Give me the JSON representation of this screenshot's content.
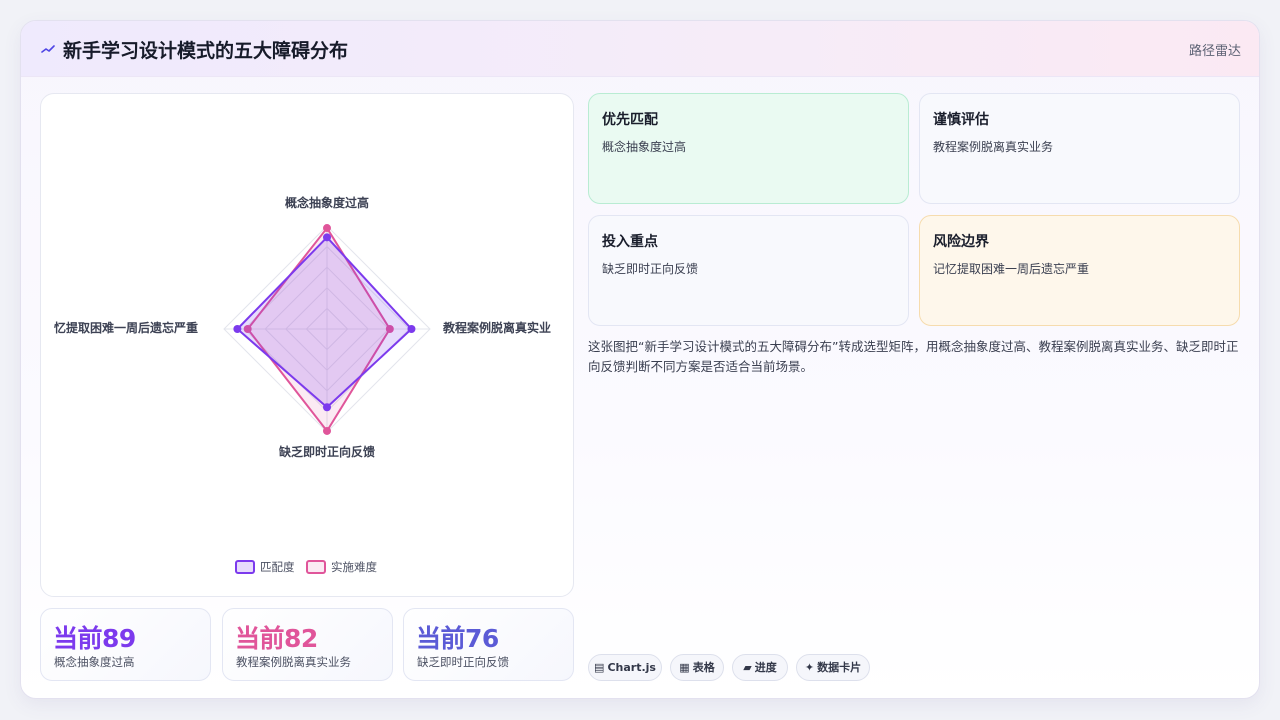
{
  "header": {
    "icon": "sparkline-icon",
    "title": "新手学习设计模式的五大障碍分布",
    "tag": "路径雷达"
  },
  "chart_data": {
    "type": "radar",
    "axes": [
      "概念抽象度过高",
      "教程案例脱离真实业务",
      "缺乏即时正向反馈",
      "记忆提取困难一周后遗忘严重"
    ],
    "axis_labels_shown": [
      "概念抽象度过高",
      "教程案例脱离真实业",
      "缺乏即时正向反馈",
      "忆提取困难一周后遗忘严重"
    ],
    "series": [
      {
        "name": "匹配度",
        "values": [
          89,
          82,
          76,
          87
        ],
        "color": "#7c3aed",
        "fill": "rgba(124,58,237,0.18)"
      },
      {
        "name": "实施难度",
        "values": [
          98,
          61,
          99,
          77
        ],
        "color": "#e0559a",
        "fill": "rgba(224,85,154,0.12)"
      }
    ],
    "rmax": 100,
    "grid_levels": 5,
    "legend": "bottom"
  },
  "stats": [
    {
      "value": "当前89",
      "label": "概念抽象度过高",
      "color": "#7c3aed"
    },
    {
      "value": "当前82",
      "label": "教程案例脱离真实业务",
      "color": "#e0559a"
    },
    {
      "value": "当前76",
      "label": "缺乏即时正向反馈",
      "color": "#5b5bd6"
    }
  ],
  "quadrants": [
    {
      "title": "优先匹配",
      "desc": "概念抽象度过高"
    },
    {
      "title": "谨慎评估",
      "desc": "教程案例脱离真实业务"
    },
    {
      "title": "投入重点",
      "desc": "缺乏即时正向反馈"
    },
    {
      "title": "风险边界",
      "desc": "记忆提取困难一周后遗忘严重"
    }
  ],
  "description": "这张图把“新手学习设计模式的五大障碍分布”转成选型矩阵，用概念抽象度过高、教程案例脱离真实业务、缺乏即时正向反馈判断不同方案是否适合当前场景。",
  "chips": [
    {
      "icon": "▤",
      "label": "Chart.js"
    },
    {
      "icon": "▦",
      "label": "表格"
    },
    {
      "icon": "▰",
      "label": "进度"
    },
    {
      "icon": "✦",
      "label": "数据卡片"
    }
  ]
}
